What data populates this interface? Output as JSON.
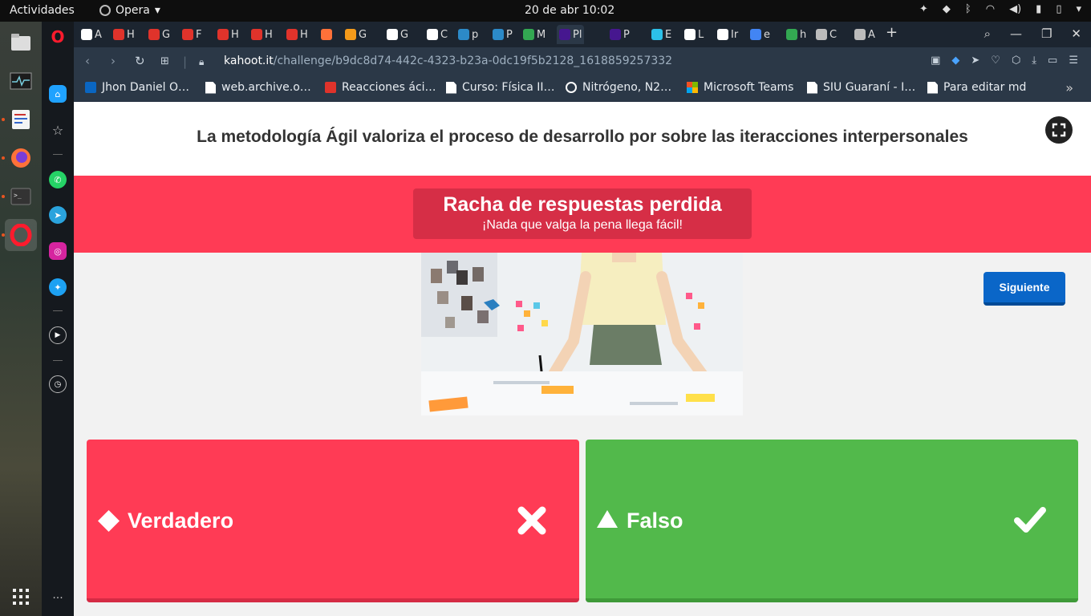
{
  "topbar": {
    "activities": "Actividades",
    "app_name": "Opera",
    "clock": "20 de abr  10:02"
  },
  "tabs": [
    {
      "label": "A",
      "icon_color": "#ffffff"
    },
    {
      "label": "H",
      "icon_color": "#e0332b"
    },
    {
      "label": "G",
      "icon_color": "#e0332b"
    },
    {
      "label": "F",
      "icon_color": "#e0332b"
    },
    {
      "label": "H",
      "icon_color": "#e0332b"
    },
    {
      "label": "H",
      "icon_color": "#e0332b"
    },
    {
      "label": "H",
      "icon_color": "#e0332b"
    },
    {
      "label": "",
      "icon_color": "#ff7139"
    },
    {
      "label": "G",
      "icon_color": "#f49a1a"
    },
    {
      "label": "G",
      "icon_color": "#ffffff"
    },
    {
      "label": "C",
      "icon_color": "#ffffff"
    },
    {
      "label": "p",
      "icon_color": "#2c8ac8"
    },
    {
      "label": "P",
      "icon_color": "#2c8ac8"
    },
    {
      "label": "M",
      "icon_color": "#33a852"
    },
    {
      "label": "Pl",
      "icon_color": "#46178f"
    },
    {
      "label": "P",
      "icon_color": "#46178f"
    },
    {
      "label": "E",
      "icon_color": "#2cc0e8"
    },
    {
      "label": "L",
      "icon_color": "#ffffff"
    },
    {
      "label": "Ir",
      "icon_color": "#ffffff"
    },
    {
      "label": "e",
      "icon_color": "#4285f4"
    },
    {
      "label": "h",
      "icon_color": "#33a852"
    },
    {
      "label": "C",
      "icon_color": "#bbbbbb"
    },
    {
      "label": "A",
      "icon_color": "#bbbbbb"
    }
  ],
  "address": {
    "host": "kahoot.it",
    "path": "/challenge/b9dc8d74-442c-4323-b23a-0dc19f5b2128_1618859257332"
  },
  "bookmarks": [
    {
      "label": "Jhon Daniel O…",
      "icon": "linkedin-icon",
      "color": "#0a66c2"
    },
    {
      "label": "web.archive.o…",
      "icon": "page-icon",
      "color": "#ffffff"
    },
    {
      "label": "Reacciones áci…",
      "icon": "red-square-icon",
      "color": "#e0332b"
    },
    {
      "label": "Curso: Física II…",
      "icon": "page-icon",
      "color": "#ffffff"
    },
    {
      "label": "Nitrógeno, N2…",
      "icon": "circle-icon",
      "color": "#ffffff"
    },
    {
      "label": "Microsoft Teams",
      "icon": "microsoft-icon",
      "color": "#f25022"
    },
    {
      "label": "SIU Guaraní - I…",
      "icon": "page-icon",
      "color": "#ffffff"
    },
    {
      "label": "Para editar md",
      "icon": "page-icon",
      "color": "#ffffff"
    }
  ],
  "kahoot": {
    "question": "La metodología  Ágil valoriza el proceso de desarrollo por sobre las iteracciones interpersonales",
    "streak_title": "Racha de respuestas perdida",
    "streak_subtitle": "¡Nada que valga la pena llega fácil!",
    "next_button": "Siguiente",
    "answers": [
      {
        "label": "Verdadero",
        "shape": "diamond",
        "color": "#ff3b55",
        "correct": false
      },
      {
        "label": "Falso",
        "shape": "triangle",
        "color": "#52b94b",
        "correct": true
      }
    ]
  }
}
